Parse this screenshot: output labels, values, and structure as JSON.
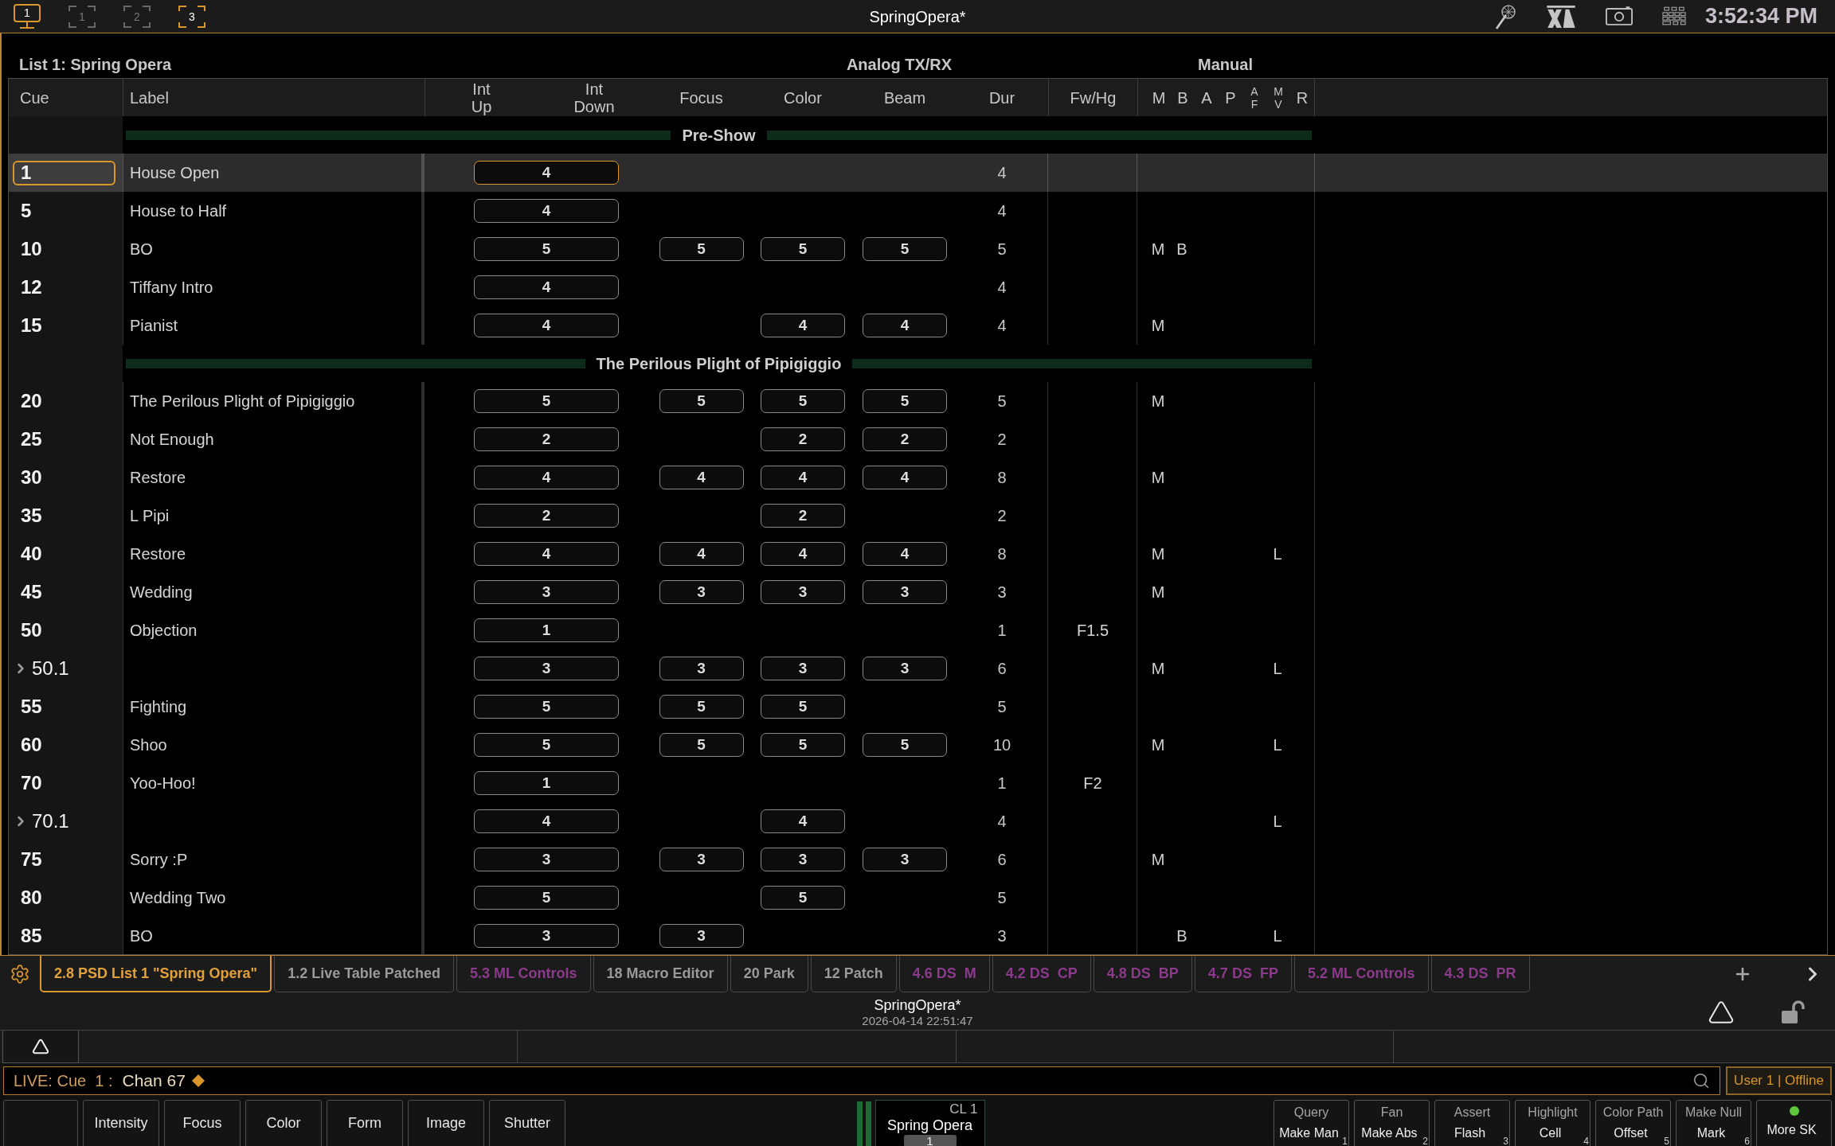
{
  "top_bar": {
    "screens": [
      {
        "kind": "monitor",
        "label": "1",
        "active": true
      },
      {
        "kind": "frame",
        "label": "1",
        "active": false
      },
      {
        "kind": "frame",
        "label": "2",
        "active": false
      },
      {
        "kind": "frame",
        "label": "3",
        "active": true
      }
    ],
    "title": "SpringOpera*",
    "clock": "3:52:34 PM"
  },
  "cue_list": {
    "title": "List 1: Spring Opera",
    "column_groups": [
      "Analog TX/RX",
      "Manual"
    ],
    "columns": [
      {
        "lines": [
          "Cue"
        ]
      },
      {
        "lines": [
          "Label"
        ]
      },
      {
        "lines": [
          "Int",
          "Up"
        ]
      },
      {
        "lines": [
          "Int",
          "Down"
        ]
      },
      {
        "lines": [
          "Focus"
        ]
      },
      {
        "lines": [
          "Color"
        ]
      },
      {
        "lines": [
          "Beam"
        ]
      },
      {
        "lines": [
          "Dur"
        ]
      },
      {
        "lines": [
          "Fw/Hg"
        ]
      }
    ],
    "manual_columns": [
      {
        "lines": [
          "M"
        ]
      },
      {
        "lines": [
          "B"
        ]
      },
      {
        "lines": [
          "A"
        ]
      },
      {
        "lines": [
          "P"
        ]
      },
      {
        "lines": [
          "A",
          "F"
        ]
      },
      {
        "lines": [
          "M",
          "V"
        ]
      },
      {
        "lines": [
          "R"
        ]
      }
    ],
    "rows": [
      {
        "kind": "part",
        "label": "Pre-Show"
      },
      {
        "kind": "cue",
        "cue": "1",
        "label": "House Open",
        "int_time": "4",
        "dur": "4",
        "selected": true
      },
      {
        "kind": "cue",
        "cue": "5",
        "label": "House to Half",
        "int_time": "4",
        "dur": "4",
        "selected": false
      },
      {
        "kind": "cue",
        "cue": "10",
        "label": "BO",
        "int_time": "5",
        "focus_time": "5",
        "color_time": "5",
        "beam_time": "5",
        "dur": "5",
        "manual": {
          "M": "M",
          "B": "B"
        },
        "selected": false
      },
      {
        "kind": "cue",
        "cue": "12",
        "label": "Tiffany Intro",
        "int_time": "4",
        "dur": "4",
        "selected": false
      },
      {
        "kind": "cue",
        "cue": "15",
        "label": "Pianist",
        "int_time": "4",
        "color_time": "4",
        "beam_time": "4",
        "dur": "4",
        "manual": {
          "M": "M"
        },
        "selected": false
      },
      {
        "kind": "part",
        "label": "The Perilous Plight of Pipigiggio"
      },
      {
        "kind": "cue",
        "cue": "20",
        "label": "The Perilous Plight of Pipigiggio",
        "int_time": "5",
        "focus_time": "5",
        "color_time": "5",
        "beam_time": "5",
        "dur": "5",
        "manual": {
          "M": "M"
        },
        "selected": false
      },
      {
        "kind": "cue",
        "cue": "25",
        "label": "Not Enough",
        "int_time": "2",
        "color_time": "2",
        "beam_time": "2",
        "dur": "2",
        "selected": false
      },
      {
        "kind": "cue",
        "cue": "30",
        "label": "Restore",
        "int_time": "4",
        "focus_time": "4",
        "color_time": "4",
        "beam_time": "4",
        "dur": "8",
        "manual": {
          "M": "M"
        },
        "selected": false
      },
      {
        "kind": "cue",
        "cue": "35",
        "label": "L Pipi",
        "int_time": "2",
        "color_time": "2",
        "dur": "2",
        "selected": false
      },
      {
        "kind": "cue",
        "cue": "40",
        "label": "Restore",
        "int_time": "4",
        "focus_time": "4",
        "color_time": "4",
        "beam_time": "4",
        "dur": "8",
        "manual": {
          "M": "M",
          "MV": "L"
        },
        "selected": false
      },
      {
        "kind": "cue",
        "cue": "45",
        "label": "Wedding",
        "int_time": "3",
        "focus_time": "3",
        "color_time": "3",
        "beam_time": "3",
        "dur": "3",
        "manual": {
          "M": "M"
        },
        "selected": false
      },
      {
        "kind": "cue",
        "cue": "50",
        "label": "Objection",
        "int_time": "1",
        "dur": "1",
        "fw_hg": "F1.5",
        "selected": false
      },
      {
        "kind": "point",
        "cue": "50.1",
        "expanded": false,
        "int_time": "3",
        "focus_time": "3",
        "color_time": "3",
        "beam_time": "3",
        "dur": "6",
        "manual": {
          "M": "M",
          "MV": "L"
        },
        "selected": false
      },
      {
        "kind": "cue",
        "cue": "55",
        "label": "Fighting",
        "int_time": "5",
        "focus_time": "5",
        "color_time": "5",
        "dur": "5",
        "selected": false
      },
      {
        "kind": "cue",
        "cue": "60",
        "label": "Shoo",
        "int_time": "5",
        "focus_time": "5",
        "color_time": "5",
        "beam_time": "5",
        "dur": "10",
        "manual": {
          "M": "M",
          "MV": "L"
        },
        "selected": false
      },
      {
        "kind": "cue",
        "cue": "70",
        "label": "Yoo-Hoo!",
        "int_time": "1",
        "dur": "1",
        "fw_hg": "F2",
        "selected": false
      },
      {
        "kind": "point",
        "cue": "70.1",
        "expanded": false,
        "int_time": "4",
        "color_time": "4",
        "dur": "4",
        "manual": {
          "MV": "L"
        },
        "selected": false
      },
      {
        "kind": "cue",
        "cue": "75",
        "label": "Sorry :P",
        "int_time": "3",
        "focus_time": "3",
        "color_time": "3",
        "beam_time": "3",
        "dur": "6",
        "manual": {
          "M": "M"
        },
        "selected": false
      },
      {
        "kind": "cue",
        "cue": "80",
        "label": "Wedding Two",
        "int_time": "5",
        "color_time": "5",
        "dur": "5",
        "selected": false
      },
      {
        "kind": "cue",
        "cue": "85",
        "label": "BO",
        "int_time": "3",
        "focus_time": "3",
        "dur": "3",
        "manual": {
          "B": "B",
          "MV": "L"
        },
        "selected": false
      }
    ]
  },
  "tabs": {
    "items": [
      {
        "label": "2.8 PSD List 1 \"Spring Opera\"",
        "color": "#e3a13a",
        "selected": true
      },
      {
        "label": "1.2 Live Table Patched",
        "color": "#9a9a9a",
        "selected": false
      },
      {
        "label": "5.3 ML Controls",
        "color": "#8c3a8c",
        "selected": false
      },
      {
        "label": "18 Macro Editor",
        "color": "#9a9a9a",
        "selected": false
      },
      {
        "label": "20 Park",
        "color": "#9a9a9a",
        "selected": false
      },
      {
        "label": "12 Patch",
        "color": "#9a9a9a",
        "selected": false
      },
      {
        "label": "4.6 DS  M",
        "color": "#8c3a8c",
        "selected": false
      },
      {
        "label": "4.2 DS  CP",
        "color": "#8c3a8c",
        "selected": false
      },
      {
        "label": "4.8 DS  BP",
        "color": "#8c3a8c",
        "selected": false
      },
      {
        "label": "4.7 DS  FP",
        "color": "#8c3a8c",
        "selected": false
      },
      {
        "label": "5.2 ML Controls",
        "color": "#8c3a8c",
        "selected": false
      },
      {
        "label": "4.3 DS  PR",
        "color": "#8c3a8c",
        "selected": false
      }
    ]
  },
  "status": {
    "show_name": "SpringOpera*",
    "timestamp": "2026-04-14 22:51:47"
  },
  "command_line": {
    "prefix": "LIVE: Cue  1 :",
    "text": "Chan 67",
    "user": "User 1 | Offline"
  },
  "parameter_buttons": [
    "Intensity",
    "Focus",
    "Color",
    "Form",
    "Image",
    "Shutter"
  ],
  "cue_list_widget": {
    "list": "CL 1",
    "name": "Spring Opera",
    "cue": "1"
  },
  "softkeys": [
    {
      "top": "Query",
      "label": "Make Man",
      "number": "1"
    },
    {
      "top": "Fan",
      "label": "Make Abs",
      "number": "2"
    },
    {
      "top": "Assert",
      "label": "Flash",
      "number": "3"
    },
    {
      "top": "Highlight",
      "label": "Cell",
      "number": "4"
    },
    {
      "top": "Color Path",
      "label": "Offset",
      "number": "5"
    },
    {
      "top": "Make Null",
      "label": "Mark",
      "number": "6"
    },
    {
      "label": "More SK",
      "on": true
    }
  ]
}
